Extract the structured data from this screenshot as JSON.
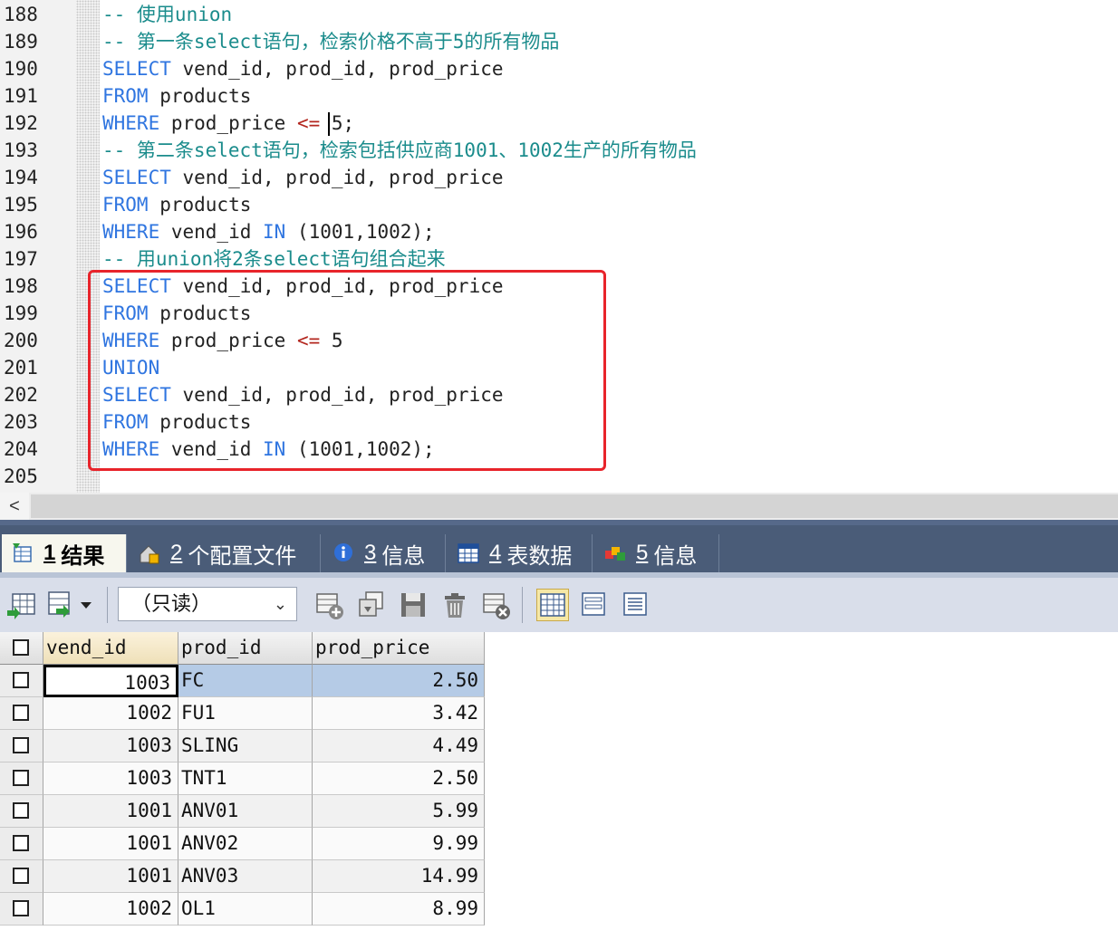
{
  "editor": {
    "lines": [
      {
        "no": "188",
        "tokens": [
          {
            "t": "-- 使用union",
            "c": "cm"
          }
        ]
      },
      {
        "no": "189",
        "tokens": [
          {
            "t": "-- 第一条select语句，检索价格不高于5的所有物品",
            "c": "cm"
          }
        ]
      },
      {
        "no": "190",
        "tokens": [
          {
            "t": "SELECT",
            "c": "kw"
          },
          {
            "t": " vend_id, prod_id, prod_price",
            "c": "id"
          }
        ]
      },
      {
        "no": "191",
        "tokens": [
          {
            "t": "FROM",
            "c": "kw"
          },
          {
            "t": " products",
            "c": "id"
          }
        ]
      },
      {
        "no": "192",
        "tokens": [
          {
            "t": "WHERE",
            "c": "kw"
          },
          {
            "t": " prod_price ",
            "c": "id"
          },
          {
            "t": "<=",
            "c": "op"
          },
          {
            "t": " 5;",
            "c": "id"
          }
        ]
      },
      {
        "no": "193",
        "tokens": [
          {
            "t": "-- 第二条select语句，检索包括供应商1001、1002生产的所有物品",
            "c": "cm"
          }
        ]
      },
      {
        "no": "194",
        "tokens": [
          {
            "t": "SELECT",
            "c": "kw"
          },
          {
            "t": " vend_id, prod_id, prod_price",
            "c": "id"
          }
        ]
      },
      {
        "no": "195",
        "tokens": [
          {
            "t": "FROM",
            "c": "kw"
          },
          {
            "t": " products",
            "c": "id"
          }
        ]
      },
      {
        "no": "196",
        "tokens": [
          {
            "t": "WHERE",
            "c": "kw"
          },
          {
            "t": " vend_id ",
            "c": "id"
          },
          {
            "t": "IN",
            "c": "kw"
          },
          {
            "t": " (1001,1002);",
            "c": "id"
          }
        ]
      },
      {
        "no": "197",
        "tokens": [
          {
            "t": "-- 用union将2条select语句组合起来",
            "c": "cm"
          }
        ]
      },
      {
        "no": "198",
        "tokens": [
          {
            "t": "SELECT",
            "c": "kw"
          },
          {
            "t": " vend_id, prod_id, prod_price",
            "c": "id"
          }
        ]
      },
      {
        "no": "199",
        "tokens": [
          {
            "t": "FROM",
            "c": "kw"
          },
          {
            "t": " products",
            "c": "id"
          }
        ]
      },
      {
        "no": "200",
        "tokens": [
          {
            "t": "WHERE",
            "c": "kw"
          },
          {
            "t": " prod_price ",
            "c": "id"
          },
          {
            "t": "<=",
            "c": "op"
          },
          {
            "t": " 5",
            "c": "id"
          }
        ]
      },
      {
        "no": "201",
        "tokens": [
          {
            "t": "UNION",
            "c": "kw"
          }
        ]
      },
      {
        "no": "202",
        "tokens": [
          {
            "t": "SELECT",
            "c": "kw"
          },
          {
            "t": " vend_id, prod_id, prod_price",
            "c": "id"
          }
        ]
      },
      {
        "no": "203",
        "tokens": [
          {
            "t": "FROM",
            "c": "kw"
          },
          {
            "t": " products",
            "c": "id"
          }
        ]
      },
      {
        "no": "204",
        "tokens": [
          {
            "t": "WHERE",
            "c": "kw"
          },
          {
            "t": " vend_id ",
            "c": "id"
          },
          {
            "t": "IN",
            "c": "kw"
          },
          {
            "t": " (1001,1002);",
            "c": "id"
          }
        ]
      },
      {
        "no": "205",
        "tokens": []
      }
    ]
  },
  "scrollbar": {
    "left_arrow": "<"
  },
  "tabs": [
    {
      "num": "1",
      "label": "结果",
      "icon": "result-grid-icon",
      "active": true
    },
    {
      "num": "2",
      "label": "个配置文件",
      "icon": "profile-icon",
      "active": false
    },
    {
      "num": "3",
      "label": "信息",
      "icon": "info-icon",
      "active": false
    },
    {
      "num": "4",
      "label": "表数据",
      "icon": "table-data-icon",
      "active": false
    },
    {
      "num": "5",
      "label": "信息",
      "icon": "multi-info-icon",
      "active": false
    }
  ],
  "toolbar": {
    "readonly_select": "（只读）",
    "chevron": "⌄",
    "buttons": [
      "export-grid-icon",
      "import-icon",
      "insert-row-icon",
      "duplicate-row-icon",
      "save-icon",
      "delete-icon",
      "discard-icon",
      "grid-view-icon",
      "form-view-icon",
      "text-view-icon"
    ],
    "accent": "#4a5c78"
  },
  "results": {
    "columns": [
      "vend_id",
      "prod_id",
      "prod_price"
    ],
    "rows": [
      {
        "vend_id": "1003",
        "prod_id": "FC",
        "prod_price": "2.50"
      },
      {
        "vend_id": "1002",
        "prod_id": "FU1",
        "prod_price": "3.42"
      },
      {
        "vend_id": "1003",
        "prod_id": "SLING",
        "prod_price": "4.49"
      },
      {
        "vend_id": "1003",
        "prod_id": "TNT1",
        "prod_price": "2.50"
      },
      {
        "vend_id": "1001",
        "prod_id": "ANV01",
        "prod_price": "5.99"
      },
      {
        "vend_id": "1001",
        "prod_id": "ANV02",
        "prod_price": "9.99"
      },
      {
        "vend_id": "1001",
        "prod_id": "ANV03",
        "prod_price": "14.99"
      },
      {
        "vend_id": "1002",
        "prod_id": "OL1",
        "prod_price": "8.99"
      }
    ],
    "selected_row": 0
  },
  "colors": {
    "highlight_box": "#e8242b",
    "keyword": "#2f75e0",
    "comment": "#1b8c8c",
    "operator": "#b3261e"
  }
}
